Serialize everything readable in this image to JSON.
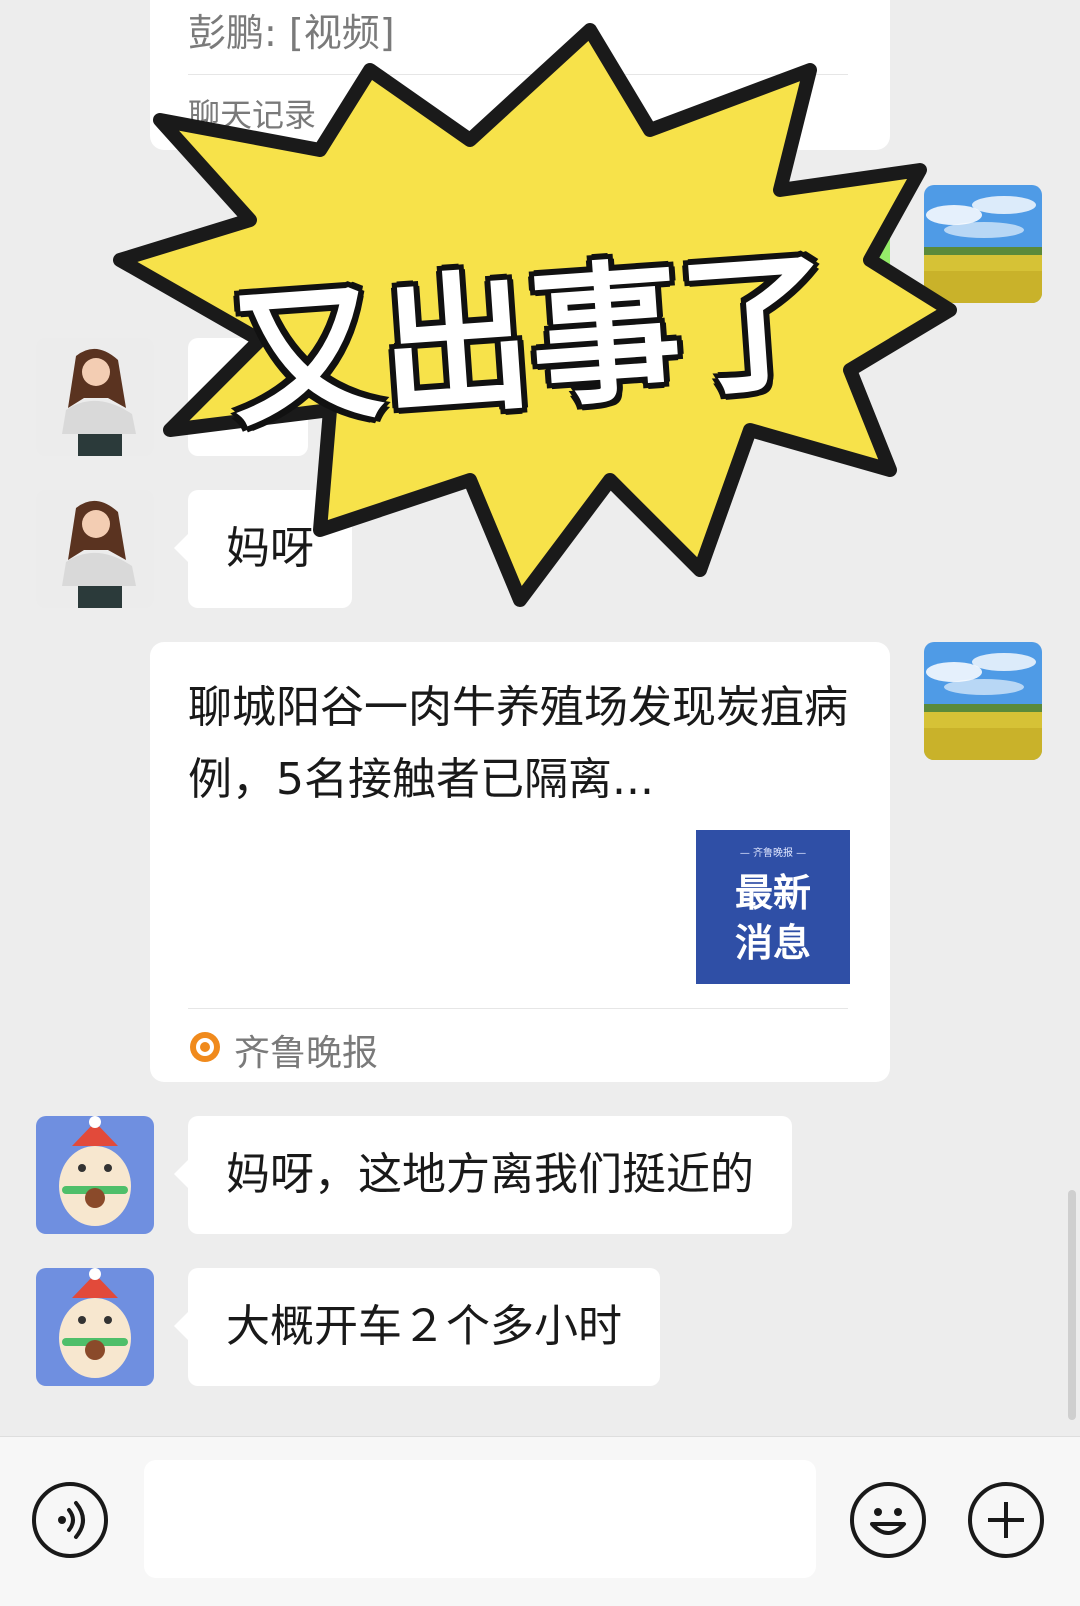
{
  "forwarded_record": {
    "line": "彭鹏: [视频]",
    "label": "聊天记录"
  },
  "overlay_banner": {
    "text": "又出事了"
  },
  "messages": [
    {
      "text": "妈呀"
    },
    {
      "text": "妈呀，这地方离我们挺近的"
    },
    {
      "text": "大概开车２个多小时"
    }
  ],
  "article": {
    "title": "聊城阳谷一肉牛养殖场发现炭疽病例，5名接触者已隔离...",
    "thumb_top": "— 齐鲁晚报 —",
    "thumb_line1": "最新",
    "thumb_line2": "消息",
    "source": "齐鲁晚报"
  },
  "icons": {
    "voice": "voice-icon",
    "emoji": "emoji-icon",
    "plus": "plus-icon",
    "source_logo": "qilu-logo-icon"
  },
  "colors": {
    "background": "#ededed",
    "bubble": "#ffffff",
    "banner_yellow": "#f7e24a",
    "thumb_blue": "#2f4fa6",
    "sent_green": "#95ec69"
  }
}
